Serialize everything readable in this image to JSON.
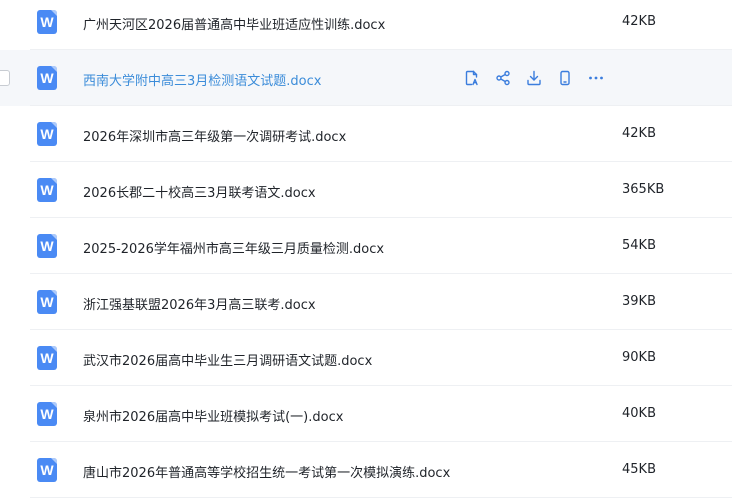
{
  "files": [
    {
      "name": "广州天河区2026届普通高中毕业班适应性训练.docx",
      "size": "42KB",
      "icon_letter": "W"
    },
    {
      "name": "西南大学附中高三3月检测语文试题.docx",
      "size": "",
      "icon_letter": "W",
      "hovered": true
    },
    {
      "name": "2026年深圳市高三年级第一次调研考试.docx",
      "size": "42KB",
      "icon_letter": "W"
    },
    {
      "name": "2026长郡二十校高三3月联考语文.docx",
      "size": "365KB",
      "icon_letter": "W"
    },
    {
      "name": "2025-2026学年福州市高三年级三月质量检测.docx",
      "size": "54KB",
      "icon_letter": "W"
    },
    {
      "name": "浙江强基联盟2026年3月高三联考.docx",
      "size": "39KB",
      "icon_letter": "W"
    },
    {
      "name": "武汉市2026届高中毕业生三月调研语文试题.docx",
      "size": "90KB",
      "icon_letter": "W"
    },
    {
      "name": "泉州市2026届高中毕业班模拟考试(一).docx",
      "size": "40KB",
      "icon_letter": "W"
    },
    {
      "name": "唐山市2026年普通高等学校招生统一考试第一次模拟演练.docx",
      "size": "45KB",
      "icon_letter": "W"
    }
  ],
  "row_actions": [
    "open-preview-icon",
    "share-icon",
    "download-icon",
    "mobile-icon",
    "more-icon"
  ],
  "colors": {
    "doc_icon": "#4a8af4",
    "hover_row": "#f5f7fa",
    "hover_text": "#3b8cd9",
    "action_icon": "#3b7ddd"
  }
}
